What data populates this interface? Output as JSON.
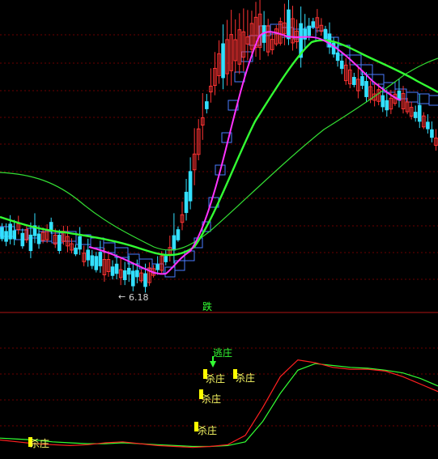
{
  "main_panel": {
    "low_price_label": "6.18",
    "low_arrow": "←",
    "divider_text": "跌"
  },
  "indicator_panel": {
    "escape_label": "逃庄",
    "kill_labels": [
      "杀庄",
      "杀庄",
      "杀庄",
      "杀庄",
      "杀庄"
    ]
  },
  "colors": {
    "background": "#000000",
    "bull_candle": "#ff3333",
    "bear_candle": "#33e0ff",
    "ma_fast": "#ff33ff",
    "ma_mid": "#33ff33",
    "ma_long": "#33dd33",
    "ladder": "#4a7cff",
    "indicator_red": "#ff2020",
    "indicator_green": "#33ff33",
    "marker_yellow": "#ffff00",
    "grid": "#6b0000"
  },
  "chart_data": {
    "type": "line",
    "title": "",
    "xlabel": "",
    "ylabel": "",
    "grid": true,
    "low_price": 6.18,
    "series": [
      {
        "values": [
          0.1,
          0.08,
          0.06,
          0.05,
          0.04,
          0.05,
          0.07,
          0.08,
          0.06,
          0.04,
          0.03,
          0.02,
          0.03,
          0.05,
          0.15,
          0.45,
          0.78,
          0.96,
          0.93,
          0.88,
          0.86,
          0.86,
          0.84,
          0.78,
          0.7,
          0.62
        ]
      },
      {
        "values": [
          0.12,
          0.11,
          0.1,
          0.08,
          0.07,
          0.06,
          0.06,
          0.07,
          0.06,
          0.05,
          0.04,
          0.03,
          0.03,
          0.04,
          0.08,
          0.3,
          0.6,
          0.85,
          0.92,
          0.9,
          0.88,
          0.87,
          0.85,
          0.82,
          0.76,
          0.68
        ]
      }
    ]
  }
}
